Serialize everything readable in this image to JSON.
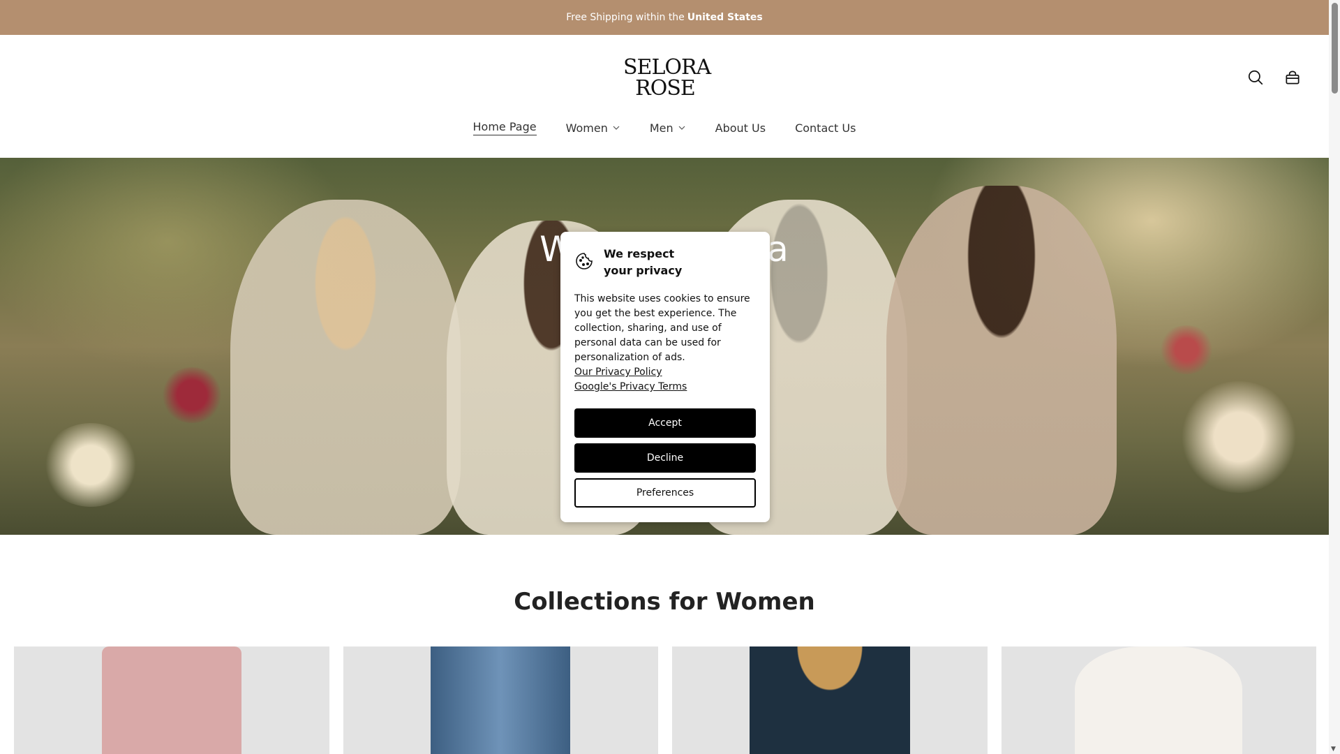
{
  "announcement": {
    "text": "Free Shipping within the",
    "highlight": "United States"
  },
  "header": {
    "logo_line1": "SELORA",
    "logo_line2": "ROSE",
    "search_icon": "search-icon",
    "cart_icon": "bag-icon"
  },
  "nav": {
    "items": [
      {
        "label": "Home Page",
        "active": true
      },
      {
        "label": "Women",
        "dropdown": true
      },
      {
        "label": "Men",
        "dropdown": true
      },
      {
        "label": "About Us"
      },
      {
        "label": "Contact Us"
      }
    ]
  },
  "hero": {
    "title_partial": "W",
    "title_partial_end": "ra"
  },
  "cookie": {
    "icon": "cookie-icon",
    "title": "We respect your privacy",
    "body": "This website uses cookies to ensure you get the best experience. The collection, sharing, and use of personal data can be used for personalization of ads.",
    "privacy_link": "Our Privacy Policy",
    "google_link": "Google's Privacy Terms",
    "accept": "Accept",
    "decline": "Decline",
    "preferences": "Preferences"
  },
  "collections": {
    "title": "Collections for Women"
  },
  "colors": {
    "announcement_bg": "#b48f6f",
    "button_dark": "#000000"
  }
}
